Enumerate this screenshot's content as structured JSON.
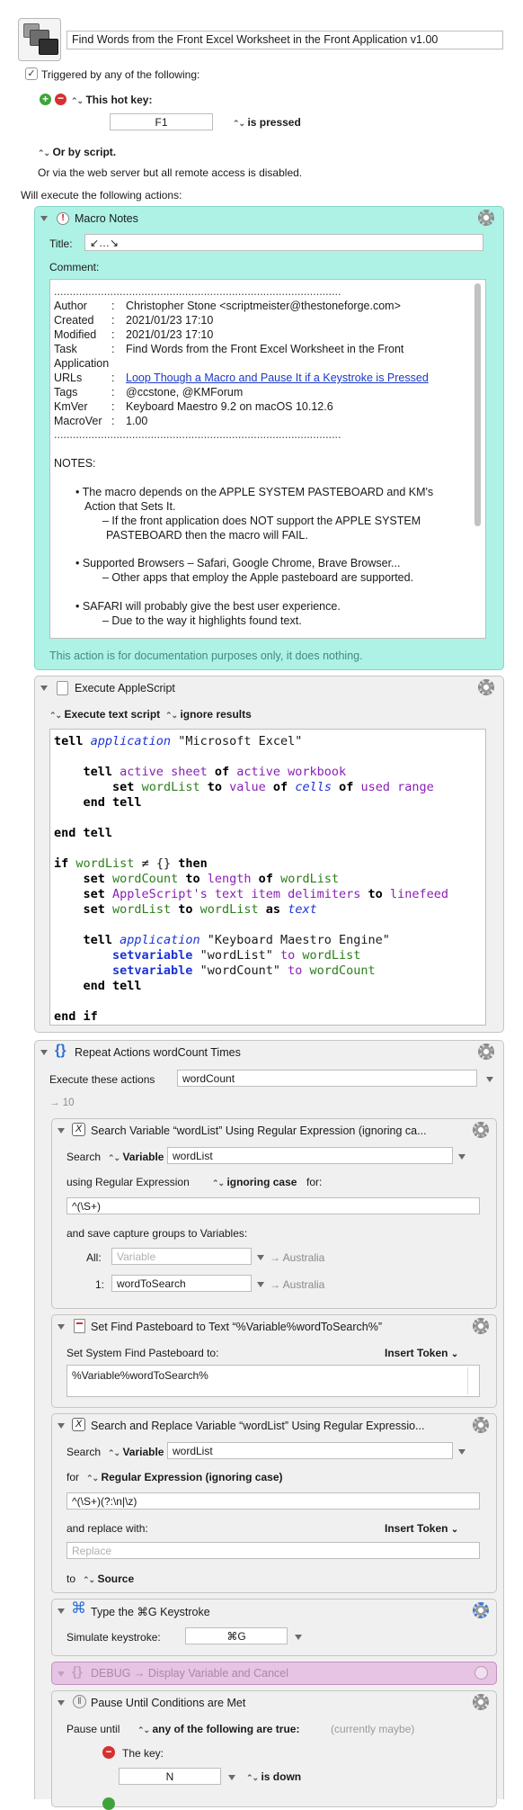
{
  "macro": {
    "name": "Find Words from the Front Excel Worksheet in the Front Application v1.00"
  },
  "trigger": {
    "checkbox_label": "Triggered by any of the following:",
    "hotkey_label": "This hot key:",
    "hotkey_value": "F1",
    "hotkey_state": "is pressed",
    "or_by_script": "Or by script.",
    "web_server_text": "Or via the web server but all remote access is disabled.",
    "will_execute": "Will execute the following actions:"
  },
  "macro_notes": {
    "title": "Macro Notes",
    "title_label": "Title:",
    "title_value": "↙…↘",
    "comment_label": "Comment:",
    "dotted": "............................................................................................",
    "rows": [
      {
        "k": "Author",
        "v": "Christopher Stone <scriptmeister@thestoneforge.com>"
      },
      {
        "k": "Created",
        "v": "2021/01/23 17:10"
      },
      {
        "k": "Modified",
        "v": "2021/01/23 17:10"
      },
      {
        "k": "Task",
        "v": "Find Words from the Front Excel Worksheet in the Front"
      },
      {
        "k": "Application",
        "v": ""
      },
      {
        "k": "URLs",
        "v": "Loop Though a Macro and Pause It if a Keystroke is Pressed"
      },
      {
        "k": "Tags",
        "v": "@ccstone, @KMForum"
      },
      {
        "k": "KmVer",
        "v": "Keyboard Maestro 9.2 on macOS 10.12.6"
      },
      {
        "k": "MacroVer",
        "v": "1.00"
      }
    ],
    "notes_heading": "NOTES:",
    "bullets": [
      "• The macro depends on the APPLE SYSTEM PASTEBOARD and KM's",
      "Action that Sets It.",
      "– If the front application does NOT support the APPLE SYSTEM",
      "PASTEBOARD then the macro will FAIL.",
      "• Supported Browsers – Safari, Google Chrome, Brave Browser...",
      "– Other apps that employ the Apple pasteboard are supported.",
      "• SAFARI will probably give the best user experience.",
      "– Due to the way it highlights found text."
    ],
    "footer": "This action is for documentation purposes only, it does nothing."
  },
  "applescript": {
    "title": "Execute AppleScript",
    "option1": "Execute text script",
    "option2": "ignore results"
  },
  "repeat": {
    "title": "Repeat Actions wordCount Times",
    "execute_label": "Execute these actions",
    "execute_value": "wordCount",
    "preview": "→ 10"
  },
  "search_var": {
    "title": "Search Variable “wordList” Using Regular Expression (ignoring ca...",
    "search_label": "Search",
    "variable_label": "Variable",
    "var_value": "wordList",
    "using_label": "using Regular Expression",
    "ignoring_label": "ignoring case",
    "for_label": "for:",
    "regex": "^(\\S+)",
    "save_label": "and save capture groups to Variables:",
    "all_label": "All:",
    "all_placeholder": "Variable",
    "all_preview": "→ Australia",
    "g1_label": "1:",
    "g1_value": "wordToSearch",
    "g1_preview": "→ Australia"
  },
  "set_find": {
    "title": "Set Find Pasteboard to Text “%Variable%wordToSearch%”",
    "label": "Set System Find Pasteboard to:",
    "insert_token": "Insert Token",
    "value": "%Variable%wordToSearch%"
  },
  "search_replace": {
    "title": "Search and Replace Variable “wordList” Using Regular Expressio...",
    "search_label": "Search",
    "variable_label": "Variable",
    "var_value": "wordList",
    "for_label": "for",
    "regex_mode": "Regular Expression (ignoring case)",
    "regex": "^(\\S+)(?:\\n|\\z)",
    "replace_label": "and replace with:",
    "insert_token": "Insert Token",
    "replace_placeholder": "Replace",
    "to_label": "to",
    "to_value": "Source"
  },
  "type_keystroke": {
    "title": "Type the ⌘G Keystroke",
    "label": "Simulate keystroke:",
    "value": "⌘G"
  },
  "debug": {
    "title": "DEBUG → Display Variable and Cancel"
  },
  "pause": {
    "title": "Pause Until Conditions are Met",
    "pause_label": "Pause until",
    "any_label": "any of the following are true:",
    "currently": "(currently maybe)",
    "key_label": "The key:",
    "key_value": "N",
    "key_state": "is down"
  }
}
